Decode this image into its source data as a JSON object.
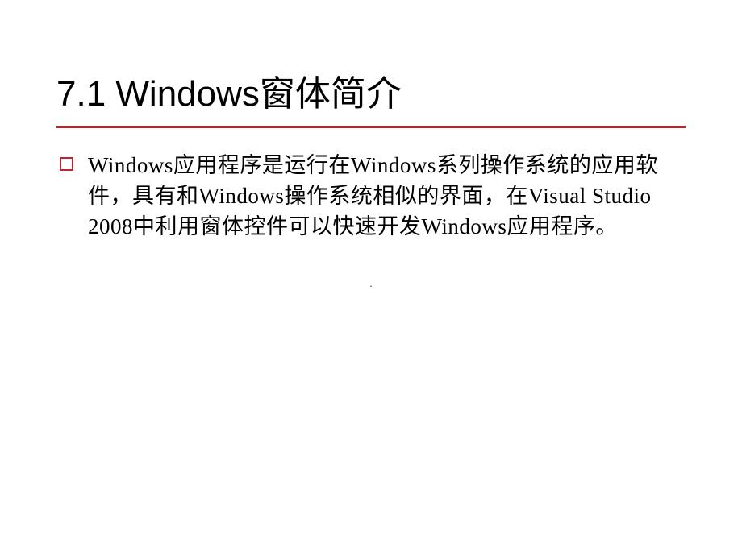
{
  "slide": {
    "title": "7.1  Windows窗体简介",
    "body": "Windows应用程序是运行在Windows系列操作系统的应用软件，具有和Windows操作系统相似的界面，在Visual Studio 2008中利用窗体控件可以快速开发Windows应用程序。",
    "footer_mark": "."
  }
}
